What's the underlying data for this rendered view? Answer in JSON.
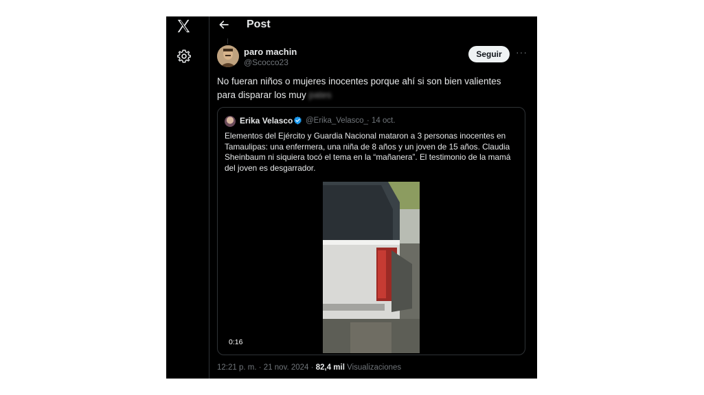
{
  "nav": {
    "logo_icon": "x-logo-icon",
    "settings_icon": "gear-icon"
  },
  "header": {
    "back_icon": "arrow-left-icon",
    "title": "Post"
  },
  "post": {
    "author_name": "paro machin",
    "author_handle": "@Scocco23",
    "follow_label": "Seguir",
    "more_label": "···",
    "text_main": "No fueran niños o mujeres inocentes porque ahí si son bien valientes para disparar los muy ",
    "text_blurred": "pates",
    "time": "12:21 p. m.",
    "separator": "·",
    "date": "21 nov. 2024",
    "views_count": "82,4 mil",
    "views_label": "Visualizaciones"
  },
  "quote": {
    "author_name": "Erika Velasco",
    "verified_icon": "verified-badge-icon",
    "author_handle": "@Erika_Velasco_",
    "date": "· 14 oct.",
    "text": "Elementos del Ejército y Guardia Nacional mataron a 3 personas inocentes en Tamaulipas: una enfermera, una niña de 8 años y un joven de 15 años. Claudia Sheinbaum ni siquiera tocó el tema en la “mañanera”. El testimonio de la mamá del joven es desgarrador.",
    "video_duration": "0:16"
  },
  "colors": {
    "background": "#000000",
    "text": "#e7e9ea",
    "secondary_text": "#71767b",
    "border": "#2f3336",
    "verified": "#1d9bf0"
  }
}
